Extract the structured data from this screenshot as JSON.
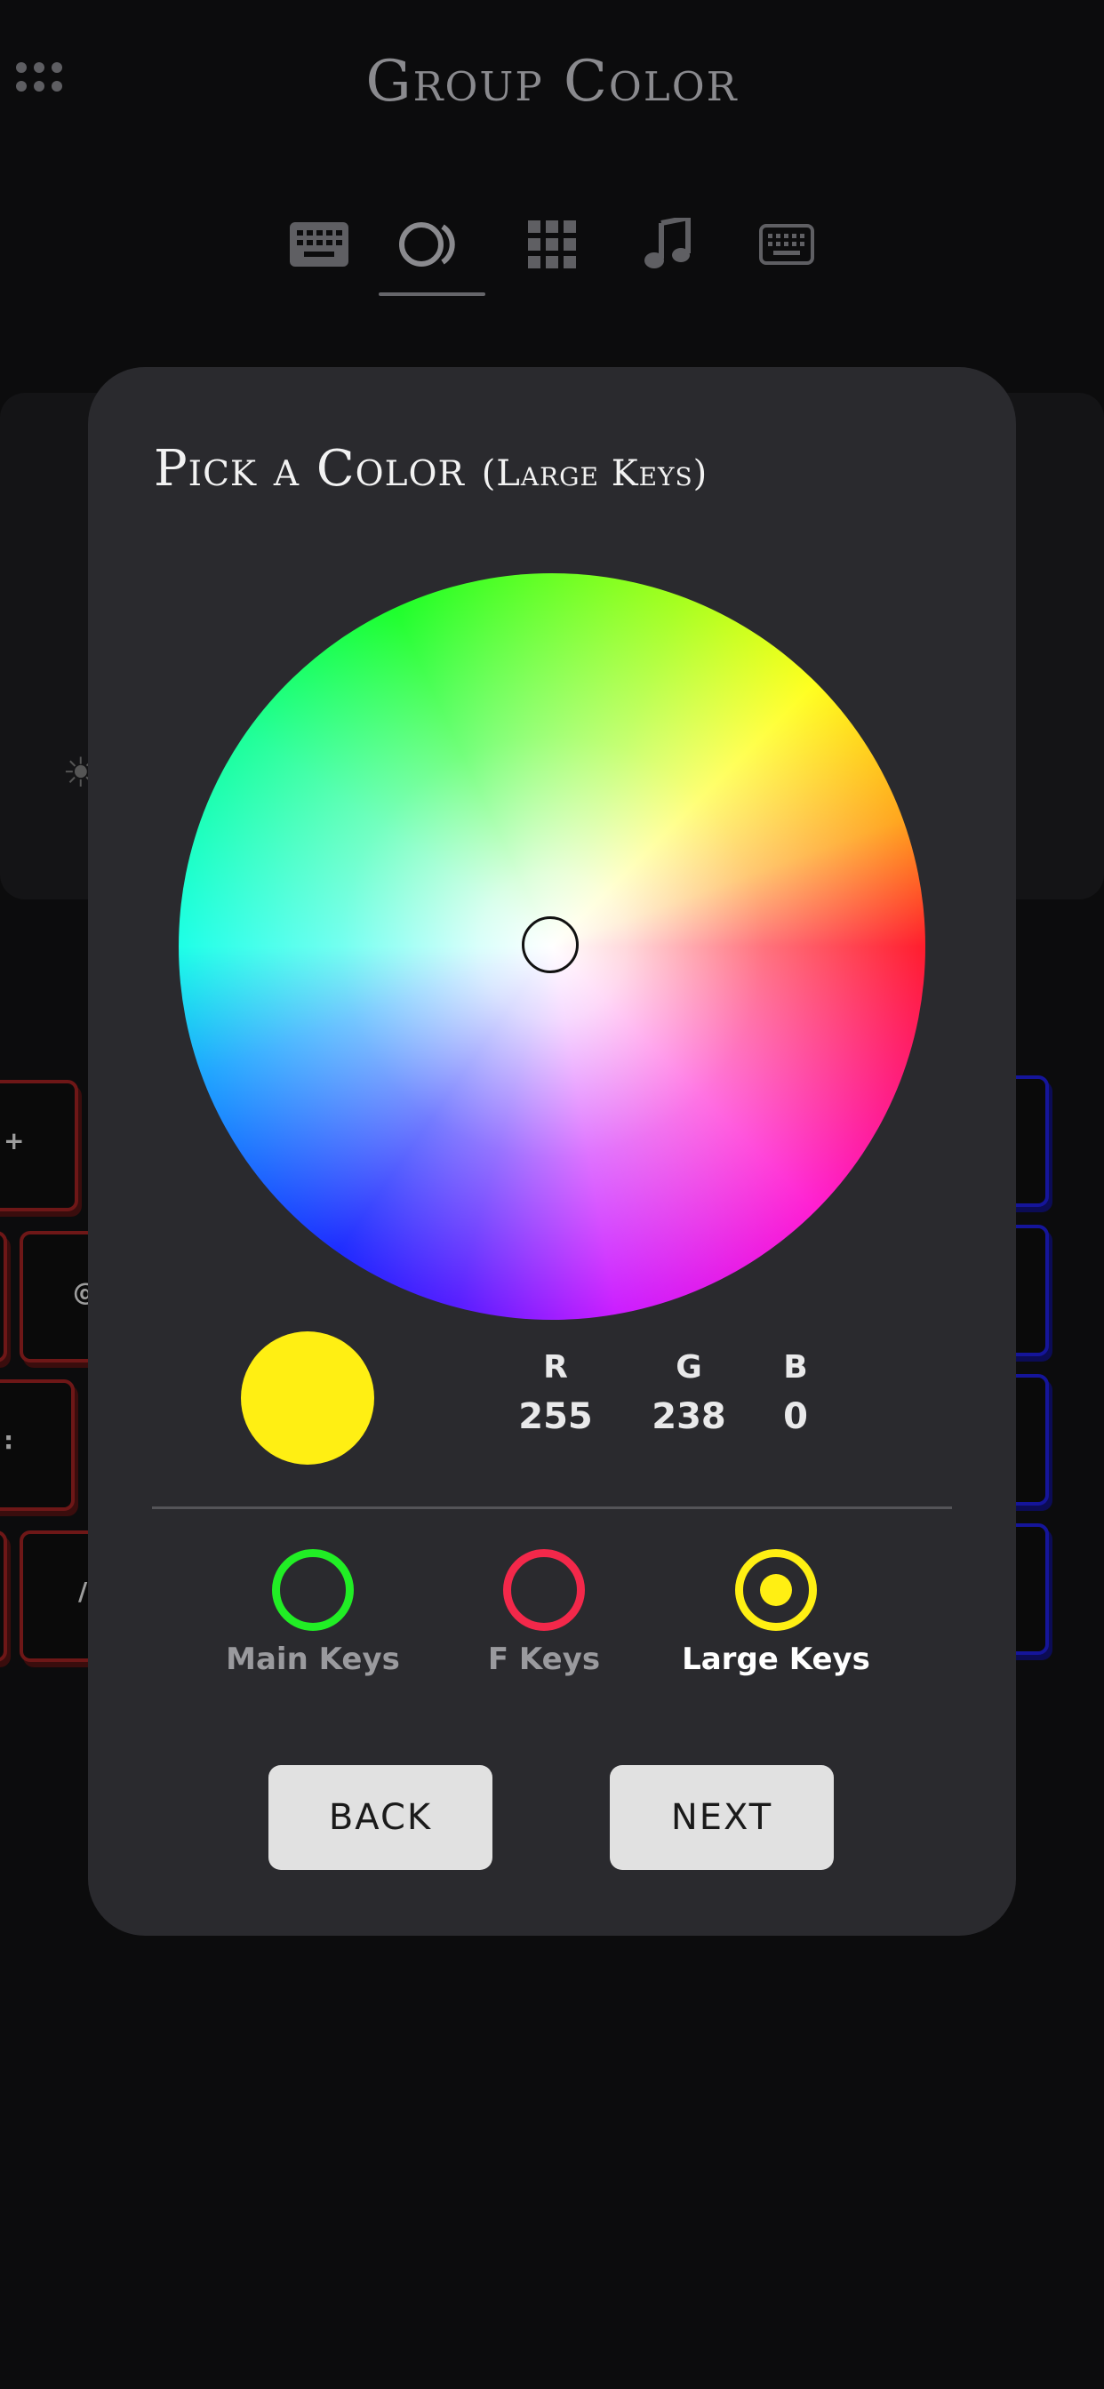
{
  "header": {
    "title": "Group Color",
    "menu_icon": "dots-grid-icon",
    "tabs": [
      {
        "icon": "keyboard-filled-icon",
        "active": false
      },
      {
        "icon": "color-rings-icon",
        "active": true
      },
      {
        "icon": "grid-icon",
        "active": false
      },
      {
        "icon": "music-note-icon",
        "active": false
      },
      {
        "icon": "keyboard-outline-icon",
        "active": false
      }
    ]
  },
  "background": {
    "keys_left": [
      "+",
      "@",
      ":",
      "/"
    ]
  },
  "modal": {
    "title": "Pick a Color",
    "subtitle": "(Large Keys)",
    "selected_color": "#ffef13",
    "rgb": {
      "r_label": "R",
      "r_value": "255",
      "g_label": "G",
      "g_value": "238",
      "b_label": "B",
      "b_value": "0"
    },
    "groups": [
      {
        "label": "Main Keys",
        "color": "#21ee25",
        "selected": false
      },
      {
        "label": "F Keys",
        "color": "#f3284a",
        "selected": false
      },
      {
        "label": "Large Keys",
        "color": "#ffef13",
        "selected": true
      }
    ],
    "back_label": "BACK",
    "next_label": "NEXT"
  },
  "colors": {
    "background": "#0c0c0d",
    "modal": "#2a2a2e",
    "button": "#e1e1e1"
  }
}
